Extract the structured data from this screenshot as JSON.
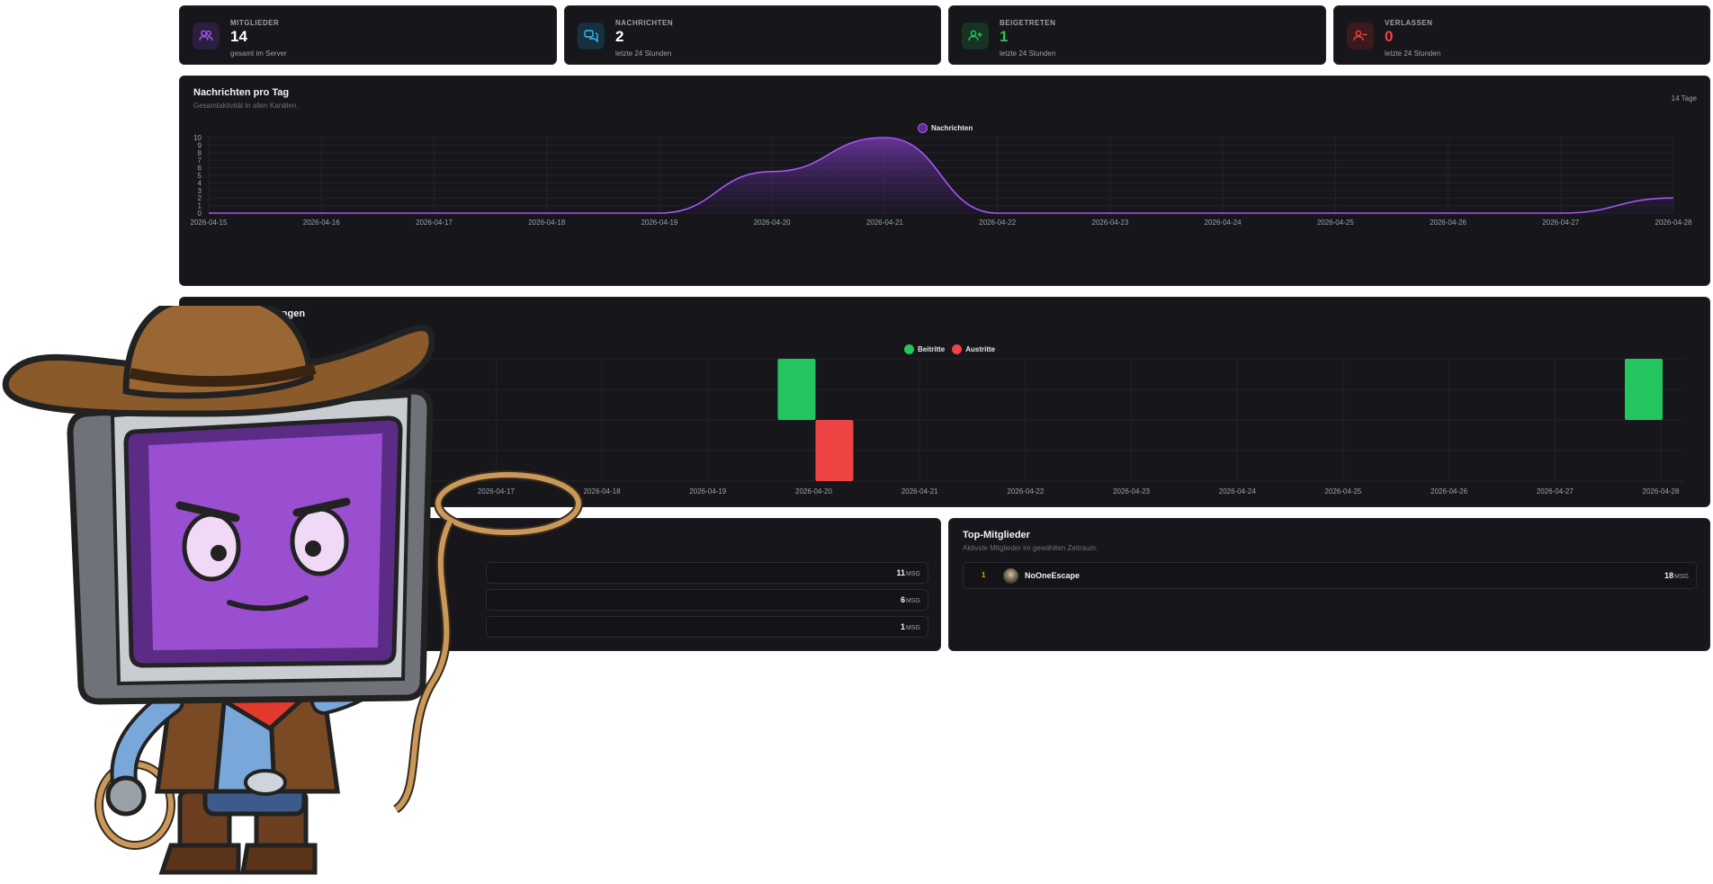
{
  "stats": [
    {
      "label": "MITGLIEDER",
      "value": "14",
      "sub": "gesamt im Server",
      "color": "#a855f7",
      "bg": "#2a1f3d",
      "icon": "users-icon"
    },
    {
      "label": "NACHRICHTEN",
      "value": "2",
      "sub": "letzte 24 Stunden",
      "color": "#38bdf8",
      "bg": "#17303f",
      "icon": "chat-icon"
    },
    {
      "label": "BEIGETRETEN",
      "value": "1",
      "sub": "letzte 24 Stunden",
      "color": "#22c55e",
      "bg": "#163323",
      "icon": "user-plus-icon"
    },
    {
      "label": "VERLASSEN",
      "value": "0",
      "sub": "letzte 24 Stunden",
      "color": "#ef4444",
      "bg": "#3a1a1d",
      "icon": "user-minus-icon"
    }
  ],
  "messages_panel": {
    "title": "Nachrichten pro Tag",
    "subtitle": "Gesamtaktivität in allen Kanälen.",
    "range_badge": "14 Tage",
    "legend": "Nachrichten"
  },
  "movements_panel": {
    "title": "Mitglieder-Bewegungen",
    "legend_join": "Beitritte",
    "legend_leave": "Austritte"
  },
  "top_members_panel": {
    "title": "Top-Mitglieder",
    "subtitle": "Aktivste Mitglieder im gewählten Zeitraum.",
    "members": [
      {
        "rank": "1",
        "name": "NoOneEscape",
        "count": "18",
        "unit": "MSG"
      }
    ]
  },
  "channels_panel": {
    "rows": [
      {
        "count": "11",
        "unit": "MSG"
      },
      {
        "count": "6",
        "unit": "MSG"
      },
      {
        "count": "1",
        "unit": "MSG"
      }
    ]
  },
  "colors": {
    "purple": "#a855f7",
    "green": "#22c55e",
    "red": "#ef4444"
  },
  "chart_data": [
    {
      "type": "area",
      "x": [
        "2026-04-15",
        "2026-04-16",
        "2026-04-17",
        "2026-04-18",
        "2026-04-19",
        "2026-04-20",
        "2026-04-21",
        "2026-04-22",
        "2026-04-23",
        "2026-04-24",
        "2026-04-25",
        "2026-04-26",
        "2026-04-27",
        "2026-04-28"
      ],
      "series": [
        {
          "name": "Nachrichten",
          "values": [
            0,
            0,
            0,
            0,
            0,
            5.5,
            10,
            0,
            0,
            0,
            0,
            0,
            0,
            2
          ]
        }
      ],
      "yticks": [
        0,
        1,
        2,
        3,
        4,
        5,
        6,
        7,
        8,
        9,
        10
      ],
      "ylim": [
        0,
        10
      ],
      "grid": true,
      "legend": "top-center"
    },
    {
      "type": "bar",
      "categories": [
        "2026-04-15",
        "2026-04-16",
        "2026-04-17",
        "2026-04-18",
        "2026-04-19",
        "2026-04-20",
        "2026-04-21",
        "2026-04-22",
        "2026-04-23",
        "2026-04-24",
        "2026-04-25",
        "2026-04-26",
        "2026-04-27",
        "2026-04-28"
      ],
      "series": [
        {
          "name": "Beitritte",
          "values": [
            0,
            0,
            0,
            0,
            0,
            1,
            0,
            0,
            0,
            0,
            0,
            0,
            0,
            1
          ]
        },
        {
          "name": "Austritte",
          "values": [
            0,
            0,
            0,
            0,
            0,
            -1,
            0,
            0,
            0,
            0,
            0,
            0,
            0,
            0
          ]
        }
      ],
      "ylim": [
        -1,
        1
      ],
      "grid": true,
      "legend": "top-center"
    }
  ],
  "mascot": {
    "icon": "cowboy-monitor-mascot-icon"
  }
}
